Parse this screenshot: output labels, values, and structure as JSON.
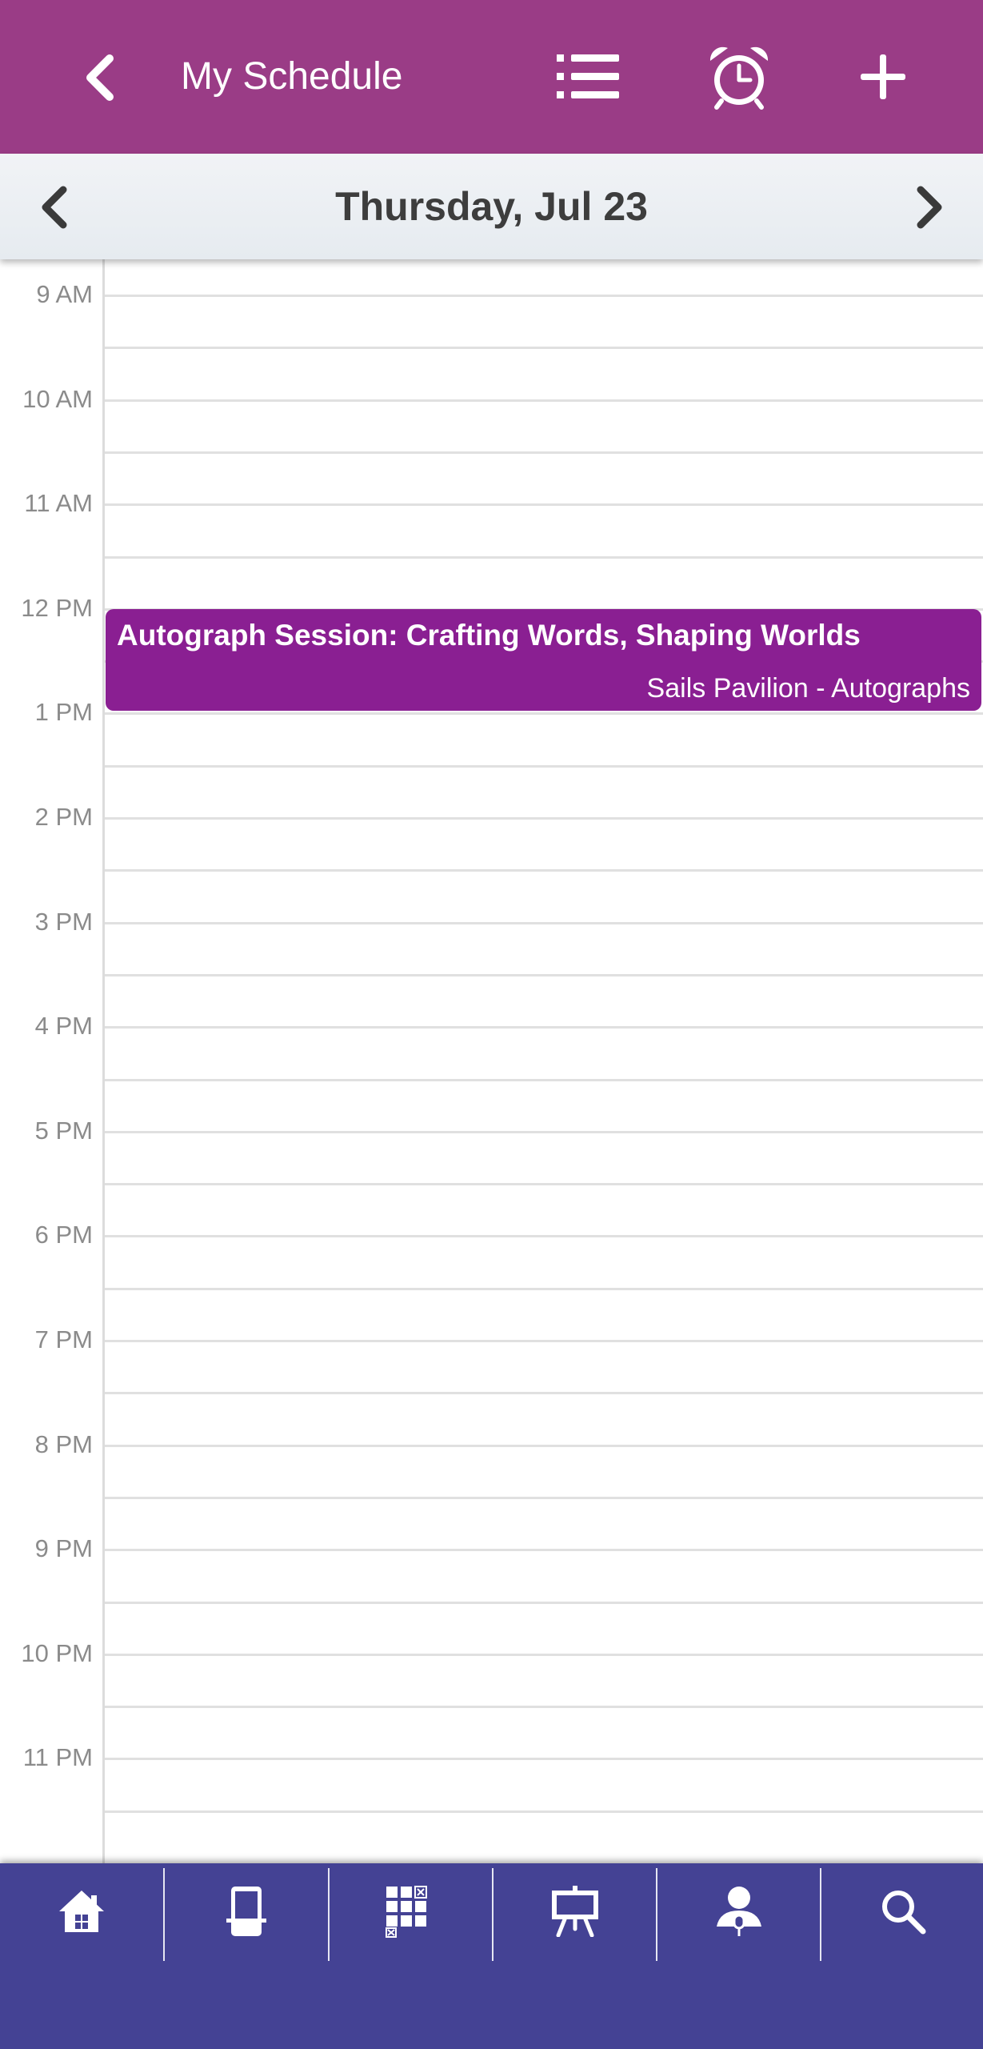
{
  "header": {
    "title": "My Schedule",
    "icons": [
      "back-chevron-icon",
      "list-icon",
      "alarm-clock-icon",
      "plus-icon"
    ]
  },
  "date_nav": {
    "date_label": "Thursday, Jul 23",
    "icons": [
      "chevron-left-icon",
      "chevron-right-icon"
    ]
  },
  "timeline": {
    "hours": [
      "9 AM",
      "10 AM",
      "11 AM",
      "12 PM",
      "1 PM",
      "2 PM",
      "3 PM",
      "4 PM",
      "5 PM",
      "6 PM",
      "7 PM",
      "8 PM",
      "9 PM",
      "10 PM",
      "11 PM"
    ]
  },
  "events": [
    {
      "title": "Autograph Session: Crafting Words, Shaping Worlds",
      "location": "Sails Pavilion - Autographs",
      "start": "12 PM",
      "end": "1 PM",
      "color": "#8a1f92"
    }
  ],
  "tab_bar": {
    "tabs": [
      {
        "icon": "home-icon"
      },
      {
        "icon": "phone-icon"
      },
      {
        "icon": "grid-icon"
      },
      {
        "icon": "presentation-easel-icon"
      },
      {
        "icon": "speaker-icon"
      },
      {
        "icon": "search-icon"
      }
    ]
  },
  "colors": {
    "header_bg": "#9a3c86",
    "tab_bar_bg": "#444294",
    "event_bg": "#8a1f92"
  }
}
